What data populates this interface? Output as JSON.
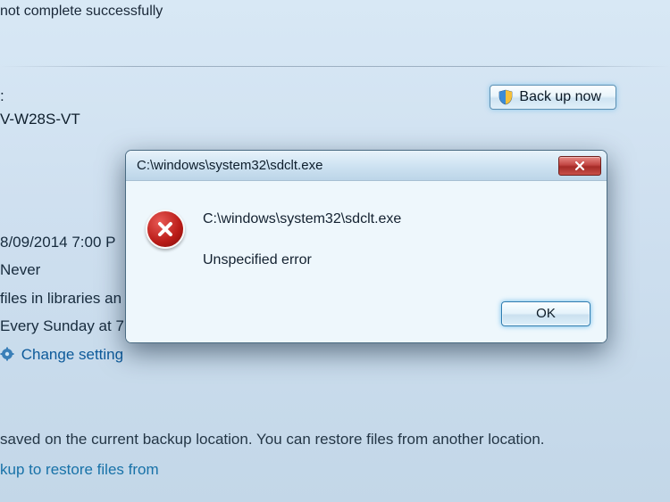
{
  "status_message": "not complete successfully",
  "device_label_suffix": ":",
  "device_name": "V-W28S-VT",
  "backup_button_label": "Back up now",
  "schedule": {
    "last_run": "8/09/2014 7:00 P",
    "next_run": "Never",
    "contents": "files in libraries an",
    "schedule_text": "Every Sunday at 7:",
    "change_settings_label": "Change setting"
  },
  "restore_line": "saved on the current backup location. You can restore files from another location.",
  "restore_link": "kup to restore files from",
  "dialog": {
    "title": "C:\\windows\\system32\\sdclt.exe",
    "message_path": "C:\\windows\\system32\\sdclt.exe",
    "message_error": "Unspecified error",
    "ok_label": "OK"
  }
}
